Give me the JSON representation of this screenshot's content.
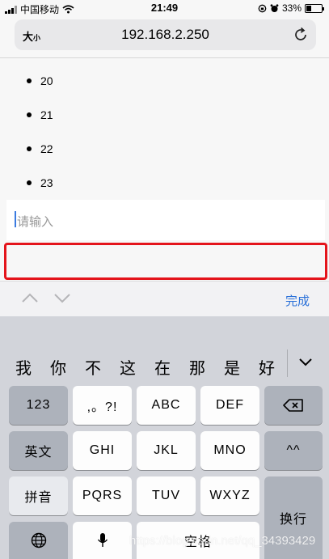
{
  "status_bar": {
    "carrier": "中国移动",
    "time": "21:49",
    "battery": "33%",
    "battery_level": 0.33
  },
  "address_bar": {
    "reader_label": "大",
    "reader_small": "小",
    "url": "192.168.2.250"
  },
  "page": {
    "list": [
      "20",
      "21",
      "22",
      "23"
    ],
    "input_placeholder": "请输入"
  },
  "accessory": {
    "done_label": "完成"
  },
  "keyboard": {
    "candidates": [
      "我",
      "你",
      "不",
      "这",
      "在",
      "那",
      "是",
      "好"
    ],
    "keys": {
      "num": "123",
      "punct": ",。?!",
      "abc": "ABC",
      "def": "DEF",
      "english": "英文",
      "ghi": "GHI",
      "jkl": "JKL",
      "mno": "MNO",
      "face": "^^",
      "pinyin": "拼音",
      "pqrs": "PQRS",
      "tuv": "TUV",
      "wxyz": "WXYZ",
      "newline": "换行",
      "space": "空格"
    }
  },
  "watermark": "https://blog.csdn.net/qq_34393429"
}
